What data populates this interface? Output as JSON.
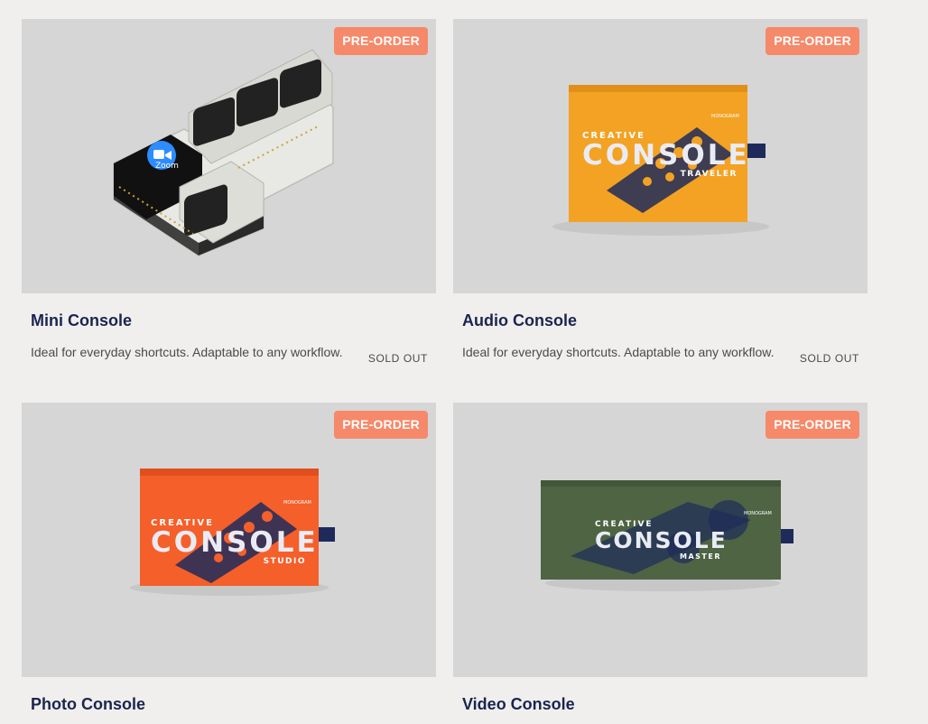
{
  "products": [
    {
      "name": "Mini Console",
      "badge": "PRE-ORDER",
      "description": "Ideal for everyday shortcuts. Adaptable to any workflow.",
      "status": "SOLD OUT",
      "image": {
        "kind": "device",
        "app_label": "Zoom"
      }
    },
    {
      "name": "Audio Console",
      "badge": "PRE-ORDER",
      "description": "Ideal for everyday shortcuts. Adaptable to any workflow.",
      "status": "SOLD OUT",
      "image": {
        "kind": "box",
        "color": "#f3a224",
        "box_kicker": "CREATIVE",
        "box_title": "CONSOLE",
        "box_edition": "TRAVELER",
        "box_brand": "MONOGRAM"
      }
    },
    {
      "name": "Photo Console",
      "badge": "PRE-ORDER",
      "image": {
        "kind": "box",
        "color": "#f55f2a",
        "box_kicker": "CREATIVE",
        "box_title": "CONSOLE",
        "box_edition": "STUDIO",
        "box_brand": "MONOGRAM"
      }
    },
    {
      "name": "Video Console",
      "badge": "PRE-ORDER",
      "image": {
        "kind": "box",
        "color": "#4e6443",
        "box_kicker": "CREATIVE",
        "box_title": "CONSOLE",
        "box_edition": "MASTER",
        "box_brand": "MONOGRAM"
      }
    }
  ],
  "colors": {
    "page_bg": "#f0efed",
    "media_bg": "#d6d6d6",
    "badge_bg": "#f6896a",
    "title": "#1b2450",
    "text": "#4a4a4a"
  }
}
